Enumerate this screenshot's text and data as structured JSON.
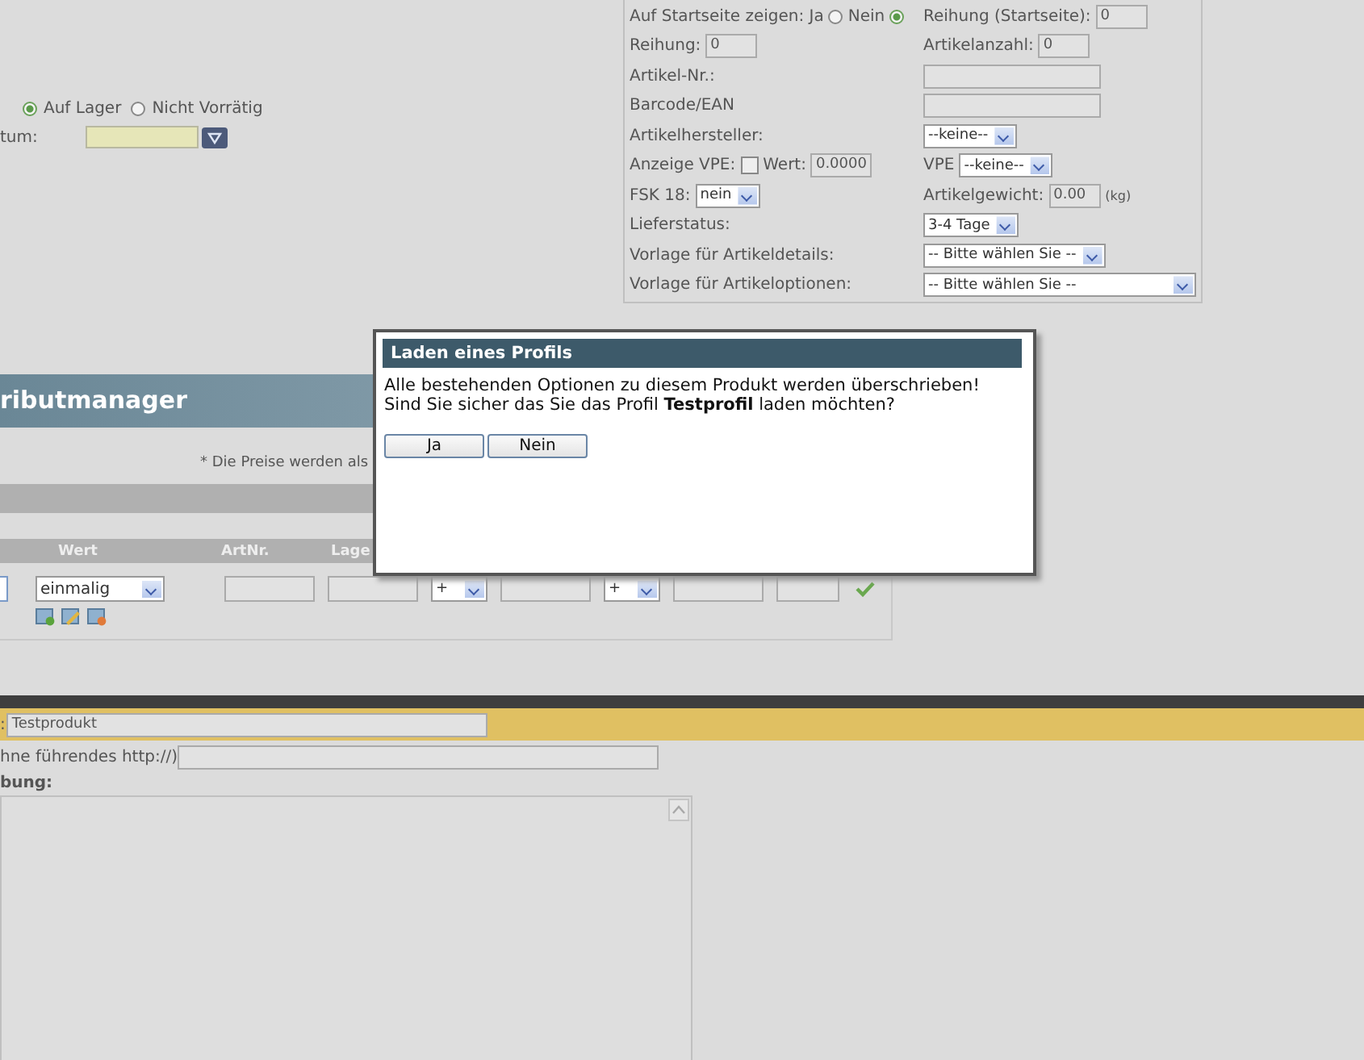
{
  "stock": {
    "radios": [
      {
        "label": "Auf Lager",
        "selected": true
      },
      {
        "label": "Nicht Vorrätig",
        "selected": false
      }
    ],
    "date_label": "tum:"
  },
  "properties": {
    "rows": [
      {
        "left": [
          {
            "kind": "label",
            "text": "Auf Startseite zeigen: Ja"
          },
          {
            "kind": "radio",
            "selected": false
          },
          {
            "kind": "label",
            "text": "Nein"
          },
          {
            "kind": "radio",
            "selected": true
          }
        ],
        "right": [
          {
            "kind": "label",
            "text": "Reihung (Startseite):"
          },
          {
            "kind": "input",
            "value": "0"
          }
        ]
      },
      {
        "left": [
          {
            "kind": "label",
            "text": "Reihung:"
          },
          {
            "kind": "input",
            "value": "0"
          }
        ],
        "right": [
          {
            "kind": "label",
            "text": "Artikelanzahl:"
          },
          {
            "kind": "input",
            "value": "0"
          }
        ]
      },
      {
        "left": [
          {
            "kind": "label",
            "text": "Artikel-Nr.:"
          }
        ],
        "right": [
          {
            "kind": "input"
          }
        ]
      },
      {
        "left": [
          {
            "kind": "label",
            "text": "Barcode/EAN"
          }
        ],
        "right": [
          {
            "kind": "input"
          }
        ]
      },
      {
        "left": [
          {
            "kind": "label",
            "text": "Artikelhersteller:"
          }
        ],
        "right": [
          {
            "kind": "select",
            "value": "--keine--"
          }
        ]
      },
      {
        "left": [
          {
            "kind": "label",
            "text": "Anzeige VPE:"
          },
          {
            "kind": "checkbox",
            "checked": false
          },
          {
            "kind": "label",
            "text": "Wert:"
          },
          {
            "kind": "input",
            "value": "0.0000"
          }
        ],
        "right": [
          {
            "kind": "label",
            "text": "VPE"
          },
          {
            "kind": "select",
            "value": "--keine--"
          }
        ]
      },
      {
        "left": [
          {
            "kind": "label",
            "text": "FSK 18:"
          },
          {
            "kind": "select",
            "value": "nein"
          }
        ],
        "right": [
          {
            "kind": "label",
            "text": "Artikelgewicht:"
          },
          {
            "kind": "input",
            "value": "0.00"
          },
          {
            "kind": "unit",
            "text": "(kg)"
          }
        ]
      },
      {
        "left": [
          {
            "kind": "label",
            "text": "Lieferstatus:"
          }
        ],
        "right": [
          {
            "kind": "select",
            "value": "3-4 Tage"
          }
        ]
      },
      {
        "left": [
          {
            "kind": "label",
            "text": "Vorlage für Artikeldetails:"
          }
        ],
        "right": [
          {
            "kind": "select",
            "value": "-- Bitte wählen Sie --"
          }
        ]
      },
      {
        "left": [
          {
            "kind": "label",
            "text": "Vorlage für Artikeloptionen:"
          }
        ],
        "right": [
          {
            "kind": "wide-select",
            "value": "-- Bitte wählen Sie --"
          }
        ]
      }
    ]
  },
  "attributes": {
    "title": "ributmanager",
    "note": "* Die Preise werden als",
    "columns": [
      "Wert",
      "ArtNr.",
      "Lage"
    ],
    "row": [
      {
        "kind": "cut-input"
      },
      {
        "kind": "select",
        "value": "einmalig"
      },
      {
        "kind": "input"
      },
      {
        "kind": "input"
      },
      {
        "kind": "select",
        "value": "+"
      },
      {
        "kind": "input"
      },
      {
        "kind": "select",
        "value": "+"
      },
      {
        "kind": "input"
      },
      {
        "kind": "input"
      },
      {
        "kind": "check"
      }
    ]
  },
  "product": {
    "name_label": ":",
    "name_value": "Testprodukt",
    "url_label": "hne führendes http://)",
    "description_label": "bung:"
  },
  "dialog": {
    "title": "Laden eines Profils",
    "message_lines": [
      "Alle bestehenden Optionen zu diesem Produkt werden überschrieben!",
      "Sind Sie sicher das Sie das Profil **Testprofil** laden möchten?"
    ],
    "buttons": [
      "Ja",
      "Nein"
    ]
  }
}
